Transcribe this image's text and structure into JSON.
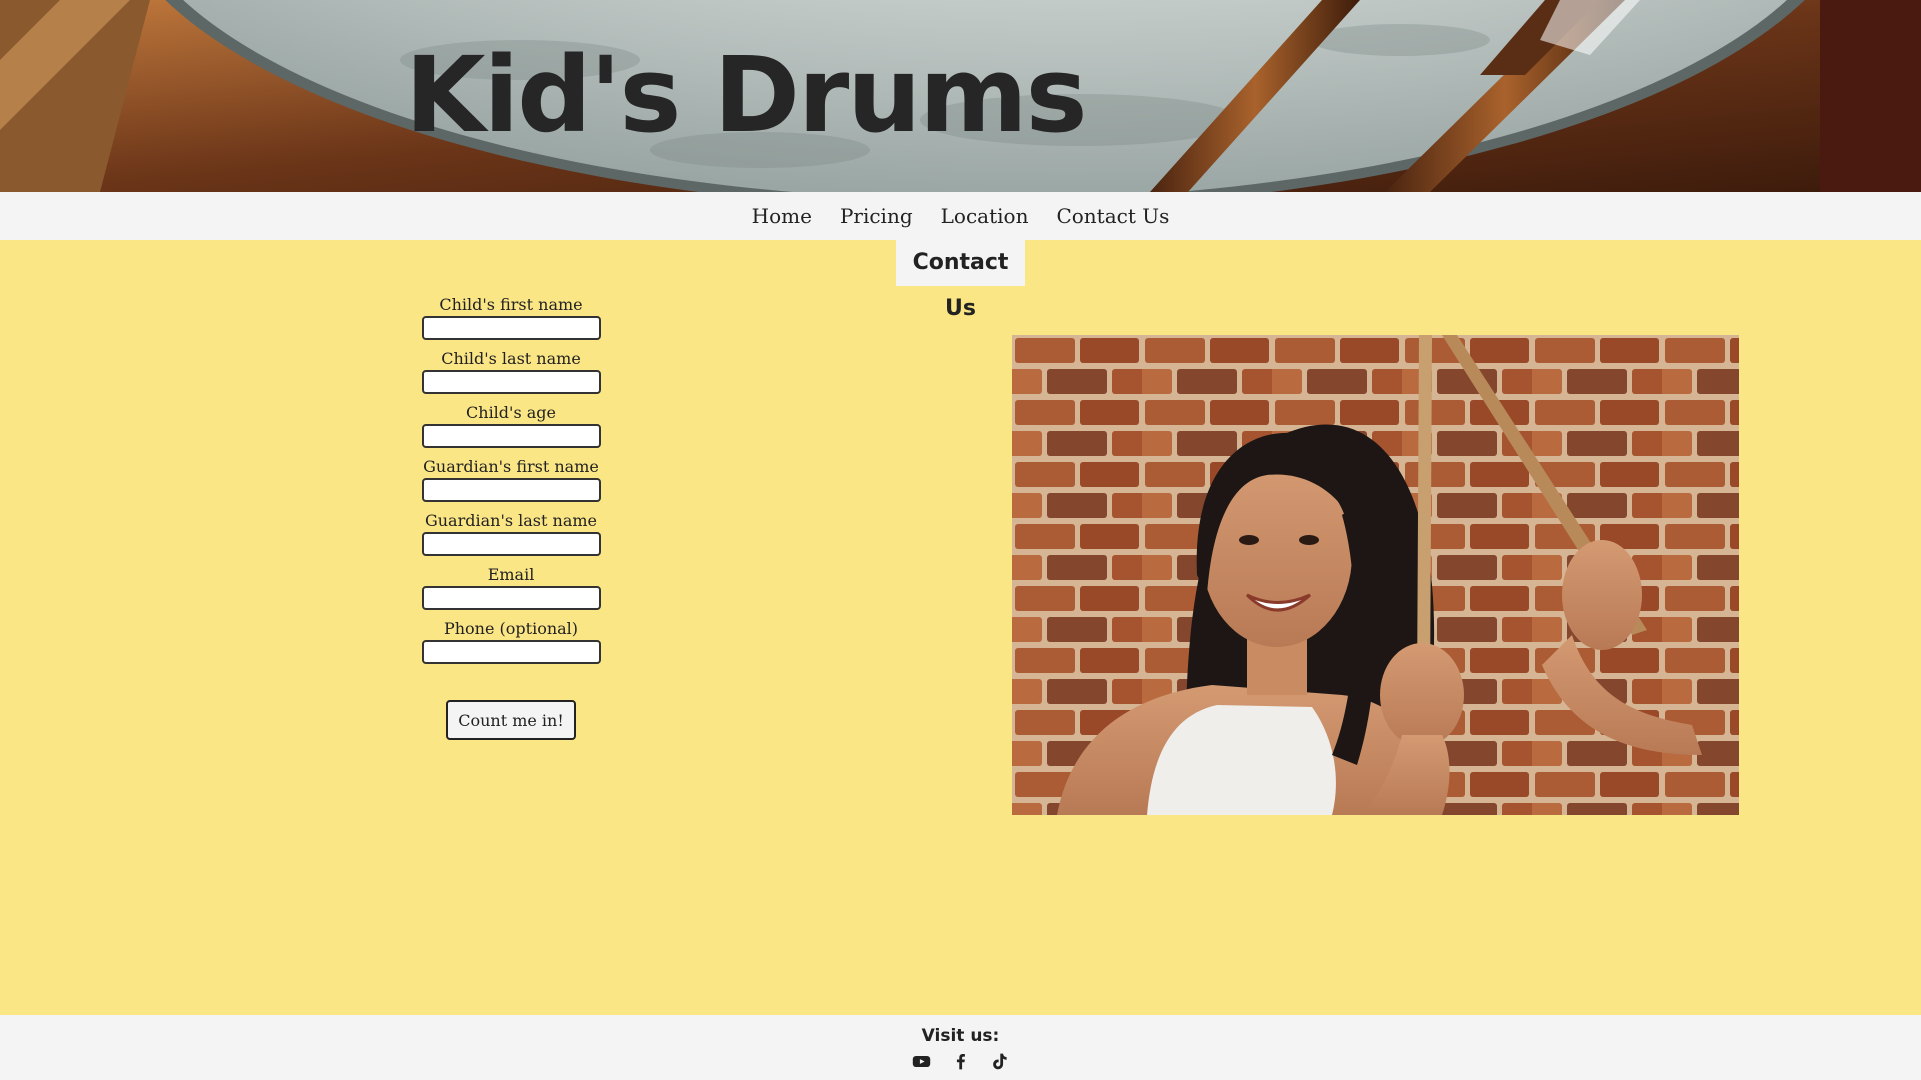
{
  "site": {
    "title": "Kid's Drums"
  },
  "nav": {
    "items": [
      {
        "label": "Home"
      },
      {
        "label": "Pricing"
      },
      {
        "label": "Location"
      },
      {
        "label": "Contact Us"
      }
    ]
  },
  "page": {
    "heading": "Contact Us"
  },
  "form": {
    "fields": [
      {
        "label": "Child's first name",
        "value": ""
      },
      {
        "label": "Child's last name",
        "value": ""
      },
      {
        "label": "Child's age",
        "value": ""
      },
      {
        "label": "Guardian's first name",
        "value": ""
      },
      {
        "label": "Guardian's last name",
        "value": ""
      },
      {
        "label": "Email",
        "value": ""
      },
      {
        "label": "Phone (optional)",
        "value": ""
      }
    ],
    "submit_label": "Count me in!"
  },
  "footer": {
    "title": "Visit us:",
    "social": [
      {
        "icon": "youtube-icon"
      },
      {
        "icon": "facebook-icon"
      },
      {
        "icon": "tiktok-icon"
      }
    ]
  },
  "colors": {
    "page_background": "#fbe685",
    "bar_background": "#f4f4f4",
    "text": "#222222"
  }
}
